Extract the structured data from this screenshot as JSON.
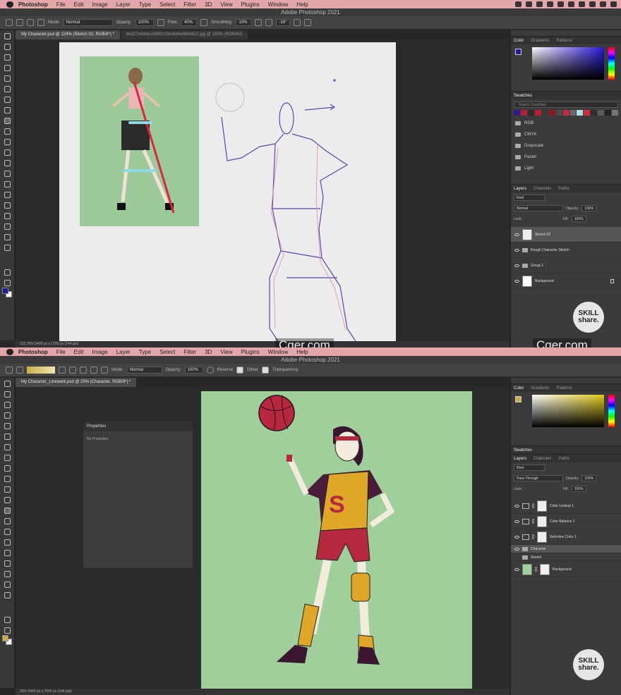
{
  "menu": {
    "app": "Photoshop",
    "items": [
      "File",
      "Edit",
      "Image",
      "Layer",
      "Type",
      "Select",
      "Filter",
      "3D",
      "View",
      "Plugins",
      "Window",
      "Help"
    ]
  },
  "window_title": "Adobe Photoshop 2021",
  "watermark": "Cger.com",
  "skillshare": {
    "line1": "SKILL",
    "line2": "share."
  },
  "s1": {
    "options": {
      "mode_label": "Mode:",
      "mode_value": "Normal",
      "opacity_label": "Opacity:",
      "opacity_value": "100%",
      "flow_label": "Flow:",
      "flow_value": "40%",
      "smoothing_label": "Smoothing:",
      "smoothing_value": "10%",
      "angle_value": "-18°"
    },
    "tabs": [
      "My Character.psd @ 124% (Sketch 02, RGB/8*) *",
      "bbd17e0d0e13d9f1cf16c6d4e5b94622.jpg @ 100% (RGB/8#)"
    ],
    "status": "123,75%     5400 px x 1750 px (144 ppi)",
    "panel_tabs": [
      "Color",
      "Gradients",
      "Patterns"
    ],
    "swatch_tabs": [
      "Swatches"
    ],
    "swatch_search": "Search Swatches",
    "swatch_colors": [
      "#2a1e8a",
      "#c01a3a",
      "#2e2e2e",
      "#b81e36",
      "#3a3a3a",
      "#8a1828",
      "#4a4a4a",
      "#c42a44",
      "#6a6a6a",
      "#a8e2e8",
      "#d22a3c",
      "#2f2f2f",
      "#5a5a5a",
      "#222222",
      "#777777"
    ],
    "swatch_folders": [
      "RGB",
      "CMYK",
      "Grayscale",
      "Pastel",
      "Light"
    ],
    "layers_tabs": [
      "Layers",
      "Channels",
      "Paths"
    ],
    "kind": "Kind",
    "blend": "Normal",
    "opacity_label": "Opacity:",
    "opacity": "100%",
    "lock_label": "Lock:",
    "fill_label": "Fill:",
    "fill": "100%",
    "layers": [
      "Sketch 02",
      "Rough Character Sketch",
      "Group 1",
      "Background"
    ]
  },
  "s2": {
    "options": {
      "mode_label": "Mode:",
      "mode_value": "Normal",
      "opacity_label": "Opacity:",
      "opacity_value": "100%",
      "reverse": "Reverse",
      "dither": "Dither",
      "transparency": "Transparency"
    },
    "tabs": [
      "My Character_Linework.psd @ 25% (Character, RGB/8*) *"
    ],
    "status": "25%     5400 px x 7000 px (144 ppi)",
    "properties_title": "Properties",
    "properties_body": "No Properties",
    "panel_tabs": [
      "Color",
      "Gradients",
      "Patterns"
    ],
    "swatch_tabs": [
      "Swatches"
    ],
    "layers_tabs": [
      "Layers",
      "Channels",
      "Paths"
    ],
    "kind": "Kind",
    "blend": "Pass Through",
    "opacity_label": "Opacity:",
    "opacity": "100%",
    "lock_label": "Lock:",
    "fill_label": "Fill:",
    "fill": "100%",
    "layers": [
      "Color Lookup 1",
      "Color Balance 1",
      "Selective Color 1",
      "Character",
      "Sketch",
      "Background"
    ]
  },
  "colors": {
    "menubar": "#e3a7a9",
    "jersey": "#e0a628",
    "shorts": "#b5283e",
    "sleeve": "#4a1e3a",
    "canvas_green": "#9fcf9a",
    "sketch_line": "#5d45b5"
  }
}
